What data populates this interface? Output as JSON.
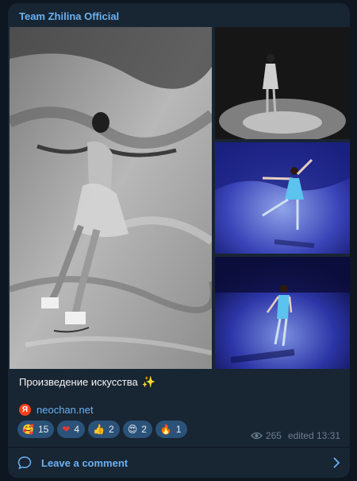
{
  "post": {
    "channel_name": "Team Zhilina Official",
    "caption": "Произведение искусства",
    "caption_emoji": "✨",
    "link_source_icon": "Я",
    "link_text": "neochan.net",
    "views": "265",
    "edited": "edited 13:31",
    "comment_label": "Leave a comment"
  },
  "reactions": [
    {
      "emoji": "🥰",
      "count": "15",
      "icon": "smiling-face-with-hearts-icon"
    },
    {
      "emoji": "❤",
      "count": "4",
      "icon": "red-heart-icon"
    },
    {
      "emoji": "👍",
      "count": "2",
      "icon": "thumbs-up-icon"
    },
    {
      "emoji": "😍",
      "count": "2",
      "icon": "heart-eyes-icon"
    },
    {
      "emoji": "🔥",
      "count": "1",
      "icon": "fire-icon"
    }
  ],
  "colors": {
    "background": "#0e1621",
    "card": "#182533",
    "accent": "#6ab2f2",
    "reaction_bg": "#2b5278",
    "meta": "#6d7f8f"
  }
}
